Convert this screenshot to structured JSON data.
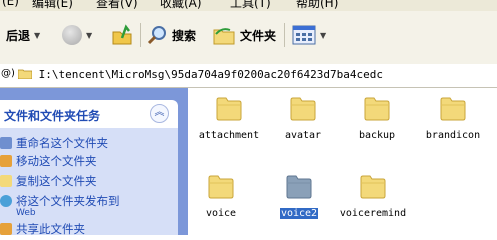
{
  "menu": {
    "items": [
      "(E)",
      "编辑(E)",
      "查看(V)",
      "收藏(A)",
      "工具(T)",
      "帮助(H)"
    ]
  },
  "toolbar": {
    "back_label": "后退",
    "search_label": "搜索",
    "folders_label": "文件夹"
  },
  "address": {
    "prefix": "@)",
    "path": "I:\\tencent\\MicroMsg\\95da704a9f0200ac20f6423d7ba4cedc"
  },
  "tasks": {
    "title": "文件和文件夹任务",
    "items": [
      {
        "label": "重命名这个文件夹"
      },
      {
        "label": "移动这个文件夹"
      },
      {
        "label": "复制这个文件夹"
      },
      {
        "label": "将这个文件夹发布到",
        "sub": "Web"
      },
      {
        "label": "共享此文件夹"
      }
    ]
  },
  "folders": [
    {
      "name": "attachment",
      "selected": false
    },
    {
      "name": "avatar",
      "selected": false
    },
    {
      "name": "backup",
      "selected": false
    },
    {
      "name": "brandicon",
      "selected": false
    },
    {
      "name": "voice",
      "selected": false
    },
    {
      "name": "voice2",
      "selected": true
    },
    {
      "name": "voiceremind",
      "selected": false
    }
  ],
  "colors": {
    "folder": "#f3d97a",
    "folder_selected": "#8aa0b8",
    "task_link": "#204bb4",
    "pane_bg": "#7c97d9",
    "selection": "#316ac5"
  }
}
